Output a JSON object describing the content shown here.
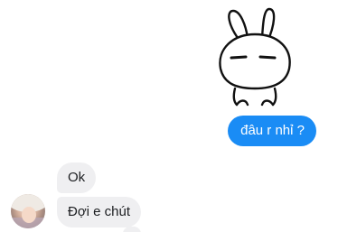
{
  "conversation": {
    "sticker": {
      "icon": "bunny-sticker-icon"
    },
    "outgoing": [
      {
        "text": "đâu r nhỉ ?"
      }
    ],
    "incoming": [
      {
        "text": "Ok"
      },
      {
        "text": "Đợi e chút"
      }
    ],
    "contact": {
      "avatar_icon": "contact-avatar-icon"
    }
  },
  "colors": {
    "outgoing_bubble": "#1a8cf5",
    "incoming_bubble": "#efeff1",
    "background": "#ffffff"
  }
}
